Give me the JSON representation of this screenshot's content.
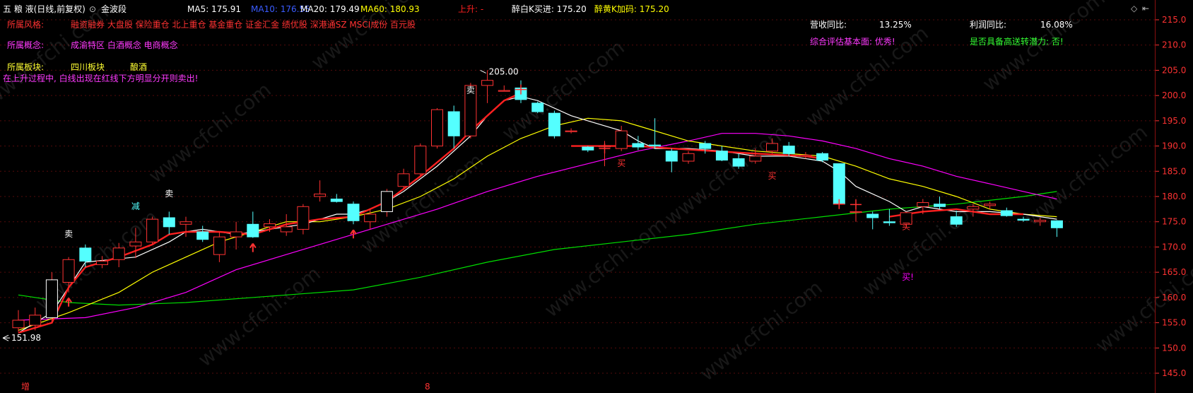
{
  "header": {
    "stock_name": "五 粮 液(日线,前复权)",
    "indicator_toggle": "金波段",
    "ma5": "MA5: 175.91",
    "ma10": "MA10: 176.55",
    "ma20": "MA20: 179.49",
    "ma60": "MA60: 180.93",
    "rise": "上升: -",
    "zuibai": "醉白K买进: 175.20",
    "zuihuang": "醉黄K加码: 175.20"
  },
  "info_panel": {
    "style_label": "所属风格:",
    "style_value": "融资融券 大盘股 保险重仓 北上重仓 基金重仓 证金汇金 绩优股 深港通SZ MSCI成份 百元股",
    "concept_label": "所属概念:",
    "concept_value": "成渝特区 白酒概念 电商概念",
    "sector_label": "所属板块:",
    "sector_value1": "四川板块",
    "sector_value2": "酿酒",
    "warning": "在上升过程中, 白线出现在红线下方明显分开则卖出!",
    "revenue_label": "营收同比:",
    "revenue_value": "13.25%",
    "profit_label": "利润同比:",
    "profit_value": "16.08%",
    "eval": "综合评估基本面: 优秀!",
    "potential": "是否具备高送转潜力: 否!"
  },
  "watermark": "www.cfchi.com",
  "colors": {
    "up": "#ff3232",
    "down": "#54ffff",
    "ma5": "#ffffff",
    "ma10": "#ffff00",
    "ma20": "#ff00ff",
    "ma60": "#00e000",
    "jinbo": "#ff2020",
    "axis": "#ff3232",
    "grid": "#7a1010"
  },
  "bottom_labels": {
    "left": "增",
    "mid": "8"
  },
  "chart_data": {
    "type": "candlestick",
    "ylim": [
      142.5,
      217.5
    ],
    "yticks": [
      "215.0",
      "210.0",
      "205.0",
      "200.0",
      "195.0",
      "190.0",
      "185.0",
      "180.0",
      "175.0",
      "170.0",
      "165.0",
      "160.0",
      "155.0",
      "150.0",
      "145.0"
    ],
    "annotations": {
      "high": "205.00",
      "low": "151.98"
    },
    "candles": [
      {
        "o": 154.0,
        "h": 157.5,
        "l": 153.2,
        "c": 155.5
      },
      {
        "o": 154.5,
        "h": 158.0,
        "l": 153.5,
        "c": 156.5
      },
      {
        "o": 156.0,
        "h": 165.0,
        "l": 155.0,
        "c": 163.5
      },
      {
        "o": 163.0,
        "h": 168.0,
        "l": 161.0,
        "c": 167.5
      },
      {
        "o": 169.8,
        "h": 170.5,
        "l": 166.0,
        "c": 167.2
      },
      {
        "o": 166.5,
        "h": 168.2,
        "l": 165.8,
        "c": 167.2
      },
      {
        "o": 167.5,
        "h": 170.8,
        "l": 166.0,
        "c": 169.8
      },
      {
        "o": 170.2,
        "h": 173.8,
        "l": 167.8,
        "c": 171.0
      },
      {
        "o": 171.0,
        "h": 176.0,
        "l": 170.5,
        "c": 175.5
      },
      {
        "o": 175.8,
        "h": 177.0,
        "l": 172.5,
        "c": 174.0
      },
      {
        "o": 174.5,
        "h": 176.0,
        "l": 172.0,
        "c": 175.0
      },
      {
        "o": 173.0,
        "h": 174.2,
        "l": 171.0,
        "c": 171.5
      },
      {
        "o": 168.5,
        "h": 173.0,
        "l": 167.0,
        "c": 172.0
      },
      {
        "o": 172.0,
        "h": 175.0,
        "l": 169.5,
        "c": 173.0
      },
      {
        "o": 174.5,
        "h": 177.0,
        "l": 171.8,
        "c": 172.0
      },
      {
        "o": 174.0,
        "h": 175.5,
        "l": 173.0,
        "c": 174.6
      },
      {
        "o": 173.0,
        "h": 176.5,
        "l": 172.2,
        "c": 174.0
      },
      {
        "o": 173.5,
        "h": 178.5,
        "l": 172.5,
        "c": 178.0
      },
      {
        "o": 180.0,
        "h": 183.2,
        "l": 179.0,
        "c": 180.5
      },
      {
        "o": 179.5,
        "h": 180.5,
        "l": 178.8,
        "c": 179.0
      },
      {
        "o": 178.5,
        "h": 179.0,
        "l": 174.5,
        "c": 175.2
      },
      {
        "o": 175.0,
        "h": 177.5,
        "l": 173.5,
        "c": 176.5
      },
      {
        "o": 177.0,
        "h": 181.5,
        "l": 176.0,
        "c": 181.0
      },
      {
        "o": 182.0,
        "h": 185.5,
        "l": 181.5,
        "c": 184.5
      },
      {
        "o": 184.5,
        "h": 190.5,
        "l": 184.0,
        "c": 190.0
      },
      {
        "o": 190.0,
        "h": 197.5,
        "l": 189.5,
        "c": 197.2
      },
      {
        "o": 196.8,
        "h": 198.0,
        "l": 189.5,
        "c": 192.0
      },
      {
        "o": 192.0,
        "h": 202.5,
        "l": 191.5,
        "c": 202.0
      },
      {
        "o": 202.0,
        "h": 205.0,
        "l": 198.5,
        "c": 203.0
      },
      {
        "o": 201.0,
        "h": 202.0,
        "l": 201.0,
        "c": 201.0
      },
      {
        "o": 201.5,
        "h": 203.0,
        "l": 198.5,
        "c": 199.2
      },
      {
        "o": 198.5,
        "h": 198.8,
        "l": 196.5,
        "c": 196.8
      },
      {
        "o": 196.5,
        "h": 197.0,
        "l": 191.5,
        "c": 192.0
      },
      {
        "o": 193.0,
        "h": 193.5,
        "l": 192.5,
        "c": 193.0
      },
      {
        "o": 189.8,
        "h": 190.0,
        "l": 188.8,
        "c": 189.2
      },
      {
        "o": 190.0,
        "h": 191.0,
        "l": 186.0,
        "c": 190.0
      },
      {
        "o": 189.5,
        "h": 194.0,
        "l": 189.0,
        "c": 193.0
      },
      {
        "o": 190.5,
        "h": 192.0,
        "l": 189.2,
        "c": 189.8
      },
      {
        "o": 190.2,
        "h": 195.5,
        "l": 189.5,
        "c": 190.0
      },
      {
        "o": 189.0,
        "h": 189.5,
        "l": 184.8,
        "c": 187.0
      },
      {
        "o": 187.0,
        "h": 189.0,
        "l": 186.5,
        "c": 188.5
      },
      {
        "o": 190.5,
        "h": 191.0,
        "l": 188.5,
        "c": 189.5
      },
      {
        "o": 189.0,
        "h": 190.0,
        "l": 187.0,
        "c": 187.2
      },
      {
        "o": 187.5,
        "h": 188.5,
        "l": 185.5,
        "c": 186.0
      },
      {
        "o": 187.0,
        "h": 189.5,
        "l": 186.5,
        "c": 188.0
      },
      {
        "o": 189.0,
        "h": 191.5,
        "l": 188.5,
        "c": 190.5
      },
      {
        "o": 190.0,
        "h": 190.8,
        "l": 188.0,
        "c": 188.5
      },
      {
        "o": 188.0,
        "h": 188.8,
        "l": 187.5,
        "c": 188.2
      },
      {
        "o": 188.5,
        "h": 188.8,
        "l": 186.8,
        "c": 187.2
      },
      {
        "o": 186.5,
        "h": 186.5,
        "l": 178.2,
        "c": 178.5
      },
      {
        "o": 177.0,
        "h": 179.5,
        "l": 175.0,
        "c": 177.0
      },
      {
        "o": 176.5,
        "h": 177.0,
        "l": 173.5,
        "c": 175.8
      },
      {
        "o": 175.0,
        "h": 177.5,
        "l": 174.2,
        "c": 174.8
      },
      {
        "o": 174.5,
        "h": 177.0,
        "l": 174.0,
        "c": 176.8
      },
      {
        "o": 178.0,
        "h": 179.5,
        "l": 176.5,
        "c": 178.8
      },
      {
        "o": 178.5,
        "h": 180.0,
        "l": 177.5,
        "c": 178.0
      },
      {
        "o": 176.0,
        "h": 177.2,
        "l": 174.0,
        "c": 174.5
      },
      {
        "o": 177.5,
        "h": 178.5,
        "l": 176.0,
        "c": 178.0
      },
      {
        "o": 178.2,
        "h": 179.0,
        "l": 177.5,
        "c": 178.5
      },
      {
        "o": 177.2,
        "h": 177.8,
        "l": 176.0,
        "c": 176.2
      },
      {
        "o": 175.5,
        "h": 176.0,
        "l": 175.0,
        "c": 175.3
      },
      {
        "o": 175.0,
        "h": 175.8,
        "l": 174.2,
        "c": 175.3
      },
      {
        "o": 175.2,
        "h": 175.3,
        "l": 172.0,
        "c": 173.8
      }
    ],
    "ma5": [
      [
        0,
        153
      ],
      [
        2,
        157
      ],
      [
        3,
        162
      ],
      [
        4,
        167
      ],
      [
        7,
        168
      ],
      [
        9,
        171
      ],
      [
        10,
        173
      ],
      [
        11,
        173.5
      ],
      [
        13,
        172.5
      ],
      [
        15,
        173.5
      ],
      [
        17,
        174.5
      ],
      [
        19,
        176.5
      ],
      [
        20,
        176.5
      ],
      [
        21,
        177.5
      ],
      [
        22,
        179
      ],
      [
        23,
        181
      ],
      [
        25,
        186
      ],
      [
        27,
        192
      ],
      [
        28,
        196
      ],
      [
        29,
        199
      ],
      [
        30,
        199.8
      ],
      [
        31,
        199
      ],
      [
        33,
        196
      ],
      [
        34,
        195
      ],
      [
        36,
        193
      ],
      [
        37,
        191
      ],
      [
        38,
        189.5
      ],
      [
        40,
        189.5
      ],
      [
        42,
        189
      ],
      [
        44,
        188
      ],
      [
        46,
        188
      ],
      [
        48,
        187
      ],
      [
        49,
        185
      ],
      [
        50,
        182
      ],
      [
        52,
        179
      ],
      [
        53,
        177
      ],
      [
        54,
        178
      ],
      [
        55,
        177.5
      ],
      [
        56,
        177
      ],
      [
        58,
        177
      ],
      [
        60,
        176.5
      ],
      [
        62,
        175.5
      ]
    ],
    "ma10": [
      [
        0,
        153.5
      ],
      [
        3,
        157
      ],
      [
        6,
        161
      ],
      [
        8,
        165
      ],
      [
        10,
        168
      ],
      [
        12,
        171
      ],
      [
        14,
        173
      ],
      [
        16,
        175
      ],
      [
        18,
        175
      ],
      [
        20,
        176
      ],
      [
        22,
        177.5
      ],
      [
        24,
        180
      ],
      [
        26,
        183.5
      ],
      [
        28,
        188
      ],
      [
        30,
        191.5
      ],
      [
        32,
        194
      ],
      [
        34,
        195.5
      ],
      [
        36,
        195
      ],
      [
        37,
        194
      ],
      [
        40,
        191
      ],
      [
        44,
        189
      ],
      [
        48,
        188
      ],
      [
        50,
        186
      ],
      [
        52,
        183.5
      ],
      [
        54,
        182
      ],
      [
        56,
        180
      ],
      [
        58,
        177.5
      ],
      [
        60,
        176.5
      ],
      [
        62,
        176
      ]
    ],
    "ma20": [
      [
        0,
        155.5
      ],
      [
        4,
        156
      ],
      [
        7,
        158
      ],
      [
        10,
        161
      ],
      [
        13,
        165.5
      ],
      [
        16,
        168.5
      ],
      [
        19,
        171.5
      ],
      [
        22,
        174.5
      ],
      [
        25,
        177.5
      ],
      [
        28,
        181
      ],
      [
        31,
        184
      ],
      [
        34,
        186.5
      ],
      [
        37,
        189
      ],
      [
        40,
        191
      ],
      [
        42,
        192.5
      ],
      [
        44,
        192.5
      ],
      [
        46,
        192
      ],
      [
        48,
        191
      ],
      [
        50,
        189.5
      ],
      [
        52,
        187.5
      ],
      [
        54,
        186
      ],
      [
        56,
        184
      ],
      [
        58,
        182.5
      ],
      [
        60,
        181
      ],
      [
        62,
        179.5
      ]
    ],
    "ma60": [
      [
        0,
        160.5
      ],
      [
        3,
        159
      ],
      [
        6,
        158.5
      ],
      [
        10,
        159
      ],
      [
        16,
        160.5
      ],
      [
        20,
        161.5
      ],
      [
        24,
        164
      ],
      [
        28,
        167
      ],
      [
        32,
        169.5
      ],
      [
        36,
        171
      ],
      [
        40,
        172.5
      ],
      [
        44,
        174.5
      ],
      [
        48,
        176
      ],
      [
        52,
        177.5
      ],
      [
        56,
        178.5
      ],
      [
        60,
        180
      ],
      [
        62,
        181
      ]
    ],
    "jinbo": [
      [
        0,
        153
      ],
      [
        2,
        155
      ],
      [
        3,
        162
      ],
      [
        4,
        166
      ],
      [
        6,
        168
      ],
      [
        8,
        170.5
      ],
      [
        9,
        172.5
      ],
      [
        10,
        173
      ],
      [
        12,
        173
      ],
      [
        14,
        172.5
      ],
      [
        16,
        174.5
      ],
      [
        18,
        175.5
      ],
      [
        20,
        176
      ],
      [
        22,
        179
      ],
      [
        24,
        184
      ],
      [
        26,
        189.5
      ],
      [
        27,
        193
      ],
      [
        28,
        196
      ],
      [
        29,
        199
      ],
      [
        30,
        200.5
      ]
    ],
    "jinbo2": [
      [
        33,
        190
      ],
      [
        37,
        190
      ],
      [
        39,
        189.5
      ],
      [
        44,
        188.5
      ],
      [
        47,
        188
      ],
      [
        48,
        187.5
      ]
    ],
    "jinbo3": [
      [
        52,
        176
      ],
      [
        54,
        177
      ],
      [
        56,
        177.5
      ],
      [
        57,
        177
      ],
      [
        58,
        176.5
      ],
      [
        60,
        176.5
      ]
    ],
    "signals": [
      {
        "i": 3,
        "y": 172.0,
        "t": "卖",
        "color": "#ffffff"
      },
      {
        "i": 7,
        "y": 177.5,
        "t": "减",
        "color": "#54ffff"
      },
      {
        "i": 9,
        "y": 180.0,
        "t": "卖",
        "color": "#ffffff"
      },
      {
        "i": 27,
        "y": 200.5,
        "t": "卖",
        "color": "#ffffff"
      },
      {
        "i": 36,
        "y": 186.0,
        "t": "买",
        "color": "#ff3232"
      },
      {
        "i": 45,
        "y": 183.5,
        "t": "买",
        "color": "#ff3232"
      },
      {
        "i": 53,
        "y": 173.5,
        "t": "买",
        "color": "#ff3232"
      },
      {
        "i": 53,
        "y": 163.5,
        "t": "买!",
        "color": "#ff00ff"
      }
    ],
    "arrows": [
      3,
      14,
      20
    ],
    "crosses": [
      [
        30,
        201.2
      ],
      [
        49,
        178.5
      ],
      [
        35,
        189.5
      ],
      [
        50,
        178.4
      ]
    ]
  }
}
